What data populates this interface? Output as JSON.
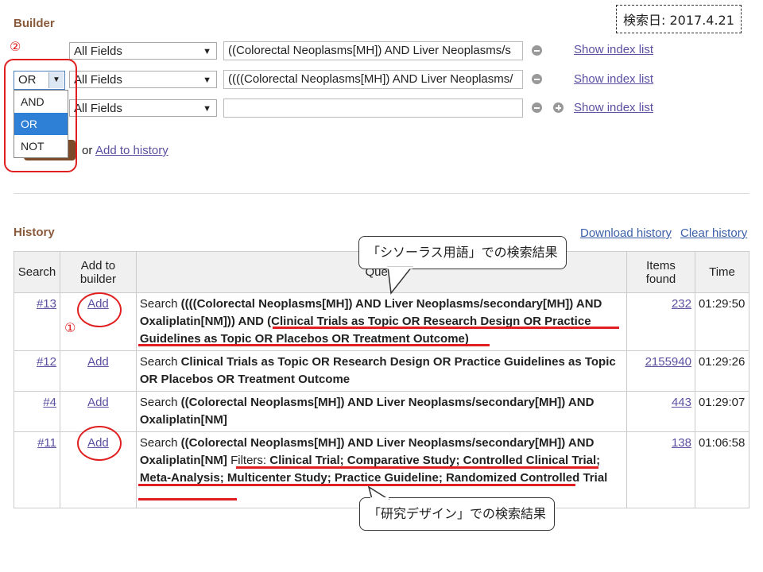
{
  "date_label": "検索日: 2017.4.21",
  "builder": {
    "title": "Builder",
    "step_marker": "②",
    "rows": [
      {
        "operator": "",
        "field": "All Fields",
        "value": "((Colorectal Neoplasms[MH]) AND Liver Neoplasms/s",
        "index_link": "Show index list"
      },
      {
        "operator": "OR",
        "field": "All Fields",
        "value": "((((Colorectal Neoplasms[MH]) AND Liver Neoplasms/",
        "index_link": "Show index list"
      },
      {
        "operator": "",
        "field": "All Fields",
        "value": "",
        "index_link": "Show index list"
      }
    ],
    "operator_options": [
      "AND",
      "OR",
      "NOT"
    ],
    "selected_operator": "OR",
    "or_text": "or",
    "add_history_link": "Add to history"
  },
  "history": {
    "title": "History",
    "download_link": "Download history",
    "clear_link": "Clear history",
    "columns": {
      "search": "Search",
      "add": "Add to builder",
      "query": "Query",
      "items": "Items found",
      "time": "Time"
    },
    "rows": [
      {
        "id": "#13",
        "add": "Add",
        "prefix": "Search ",
        "query": "((((Colorectal Neoplasms[MH]) AND Liver Neoplasms/secondary[MH]) AND Oxaliplatin[NM])) AND (Clinical Trials as Topic OR Research Design OR Practice Guidelines as Topic OR Placebos OR Treatment Outcome)",
        "items": "232",
        "time": "01:29:50"
      },
      {
        "id": "#12",
        "add": "Add",
        "prefix": "Search ",
        "query": "Clinical Trials as Topic OR Research Design OR Practice Guidelines as Topic OR Placebos OR Treatment Outcome",
        "items": "2155940",
        "time": "01:29:26"
      },
      {
        "id": "#4",
        "add": "Add",
        "prefix": "Search ",
        "query": "((Colorectal Neoplasms[MH]) AND Liver Neoplasms/secondary[MH]) AND Oxaliplatin[NM]",
        "items": "443",
        "time": "01:29:07"
      },
      {
        "id": "#11",
        "add": "Add",
        "prefix": "Search ",
        "query": "((Colorectal Neoplasms[MH]) AND Liver Neoplasms/secondary[MH]) AND Oxaliplatin[NM]",
        "filters_label": " Filters: ",
        "filters": "Clinical Trial; Comparative Study; Controlled Clinical Trial; Meta-Analysis; Multicenter Study; Practice Guideline; Randomized Controlled Trial",
        "items": "138",
        "time": "01:06:58"
      }
    ]
  },
  "annotations": {
    "marker_1": "①",
    "callout_thesaurus": "「シソーラス用語」での検索結果",
    "callout_design": "「研究デザイン」での検索結果"
  },
  "colors": {
    "annotation_red": "#e02020",
    "section_title": "#8a5a3c",
    "link": "#5a4fa0",
    "dropdown_selected": "#2e7fd6"
  }
}
